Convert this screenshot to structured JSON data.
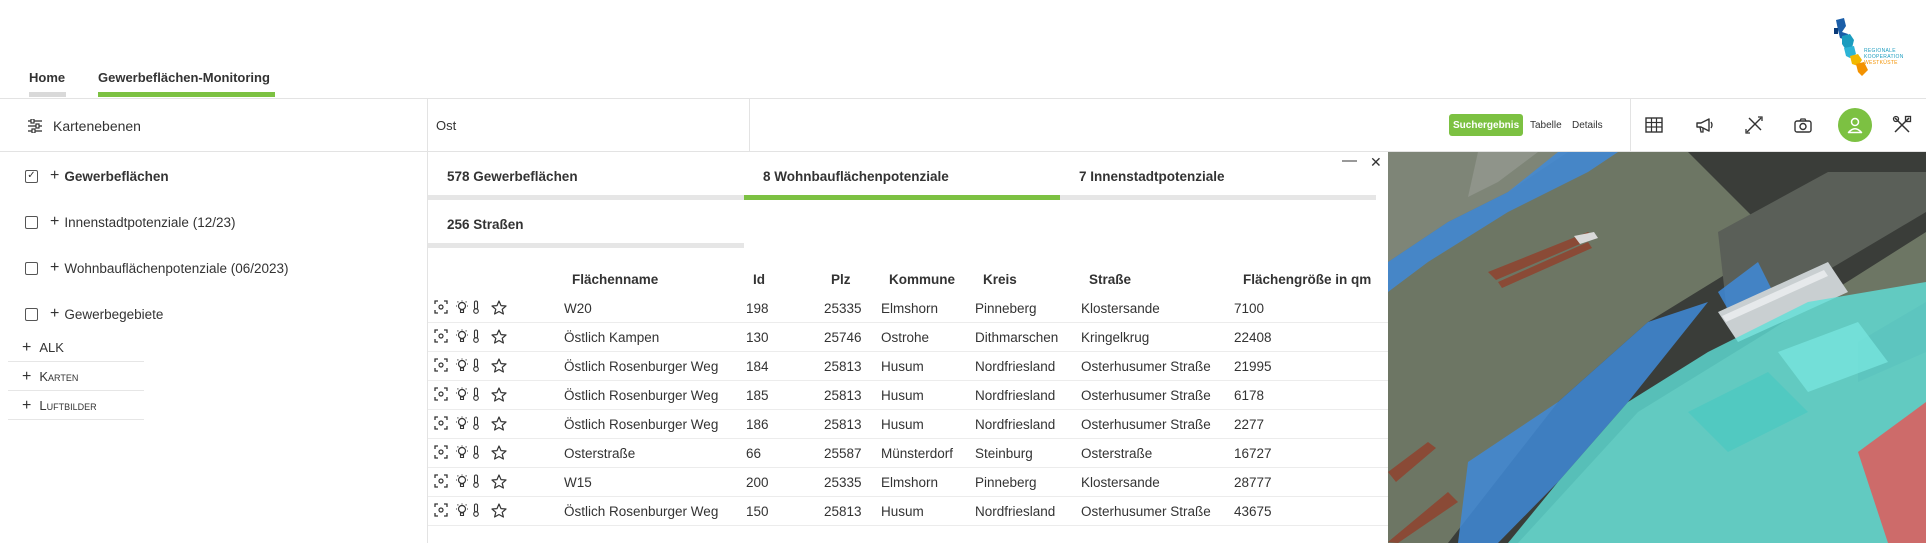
{
  "nav": {
    "tabs": [
      {
        "label": "Home",
        "underline_color": "#d9d9d9"
      },
      {
        "label": "Gewerbeflächen-Monitoring",
        "underline_color": "#7cc142"
      }
    ]
  },
  "logo": {
    "line1": "REGIONALE",
    "line2": "KOOPERATION",
    "line3": "WESTKÜSTE"
  },
  "toolbar": {
    "layers_label": "Kartenebenen",
    "search_value": "Ost",
    "view_modes": [
      "Suchergebnis",
      "Tabelle",
      "Details"
    ],
    "active_view": "Suchergebnis",
    "tool_icons": [
      "table-icon",
      "megaphone-icon",
      "measure-icon",
      "camera-icon",
      "user-icon",
      "tools-icon"
    ]
  },
  "sidebar": {
    "layers": [
      {
        "label": "Gewerbeflächen",
        "checked": true,
        "bold": true
      },
      {
        "label": "Innenstadtpotenziale (12/23)",
        "checked": false,
        "bold": false
      },
      {
        "label": "Wohnbauflächenpotenziale (06/2023)",
        "checked": false,
        "bold": false
      },
      {
        "label": "Gewerbegebiete",
        "checked": false,
        "bold": false
      }
    ],
    "groups": [
      "ALK",
      "Karten",
      "Luftbilder"
    ]
  },
  "results": {
    "tabs": [
      {
        "label": "578 Gewerbeflächen",
        "active": false
      },
      {
        "label": "8 Wohnbauflächenpotenziale",
        "active": true
      },
      {
        "label": "7 Innenstadtpotenziale",
        "active": false
      },
      {
        "label": "256 Straßen",
        "active": false
      }
    ],
    "minimize_glyph": "—",
    "close_glyph": "✕",
    "columns": [
      "Flächenname",
      "Id",
      "Plz",
      "Kommune",
      "Kreis",
      "Straße",
      "Flächengröße in qm"
    ],
    "rows": [
      [
        "W20",
        "198",
        "25335",
        "Elmshorn",
        "Pinneberg",
        "Klostersande",
        "7100"
      ],
      [
        "Östlich Kampen",
        "130",
        "25746",
        "Ostrohe",
        "Dithmarschen",
        "Kringelkrug",
        "22408"
      ],
      [
        "Östlich Rosenburger Weg",
        "184",
        "25813",
        "Husum",
        "Nordfriesland",
        "Osterhusumer Straße",
        "21995"
      ],
      [
        "Östlich Rosenburger Weg",
        "185",
        "25813",
        "Husum",
        "Nordfriesland",
        "Osterhusumer Straße",
        "6178"
      ],
      [
        "Östlich Rosenburger Weg",
        "186",
        "25813",
        "Husum",
        "Nordfriesland",
        "Osterhusumer Straße",
        "2277"
      ],
      [
        "Osterstraße",
        "66",
        "25587",
        "Münsterdorf",
        "Steinburg",
        "Osterstraße",
        "16727"
      ],
      [
        "W15",
        "200",
        "25335",
        "Elmshorn",
        "Pinneberg",
        "Klostersande",
        "28777"
      ],
      [
        "Östlich Rosenburger Weg",
        "150",
        "25813",
        "Husum",
        "Nordfriesland",
        "Osterhusumer Straße",
        "43675"
      ]
    ]
  },
  "colors": {
    "accent": "#7cc142",
    "map_blue": "#3f8ad8",
    "map_cyan": "#5fe0d8",
    "map_red": "#e05a5a",
    "map_water": "#6f7867"
  }
}
